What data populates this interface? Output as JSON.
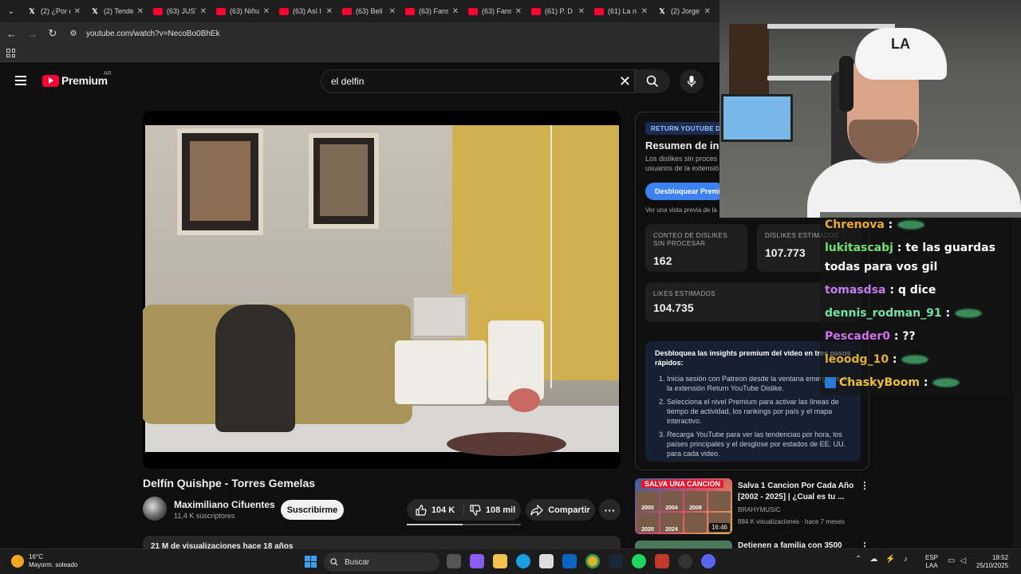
{
  "tabs": [
    {
      "icon": "x",
      "label": "(2) ¿Por q"
    },
    {
      "icon": "x",
      "label": "(2) Tende"
    },
    {
      "icon": "youtube",
      "label": "(63) JUST"
    },
    {
      "icon": "youtube",
      "label": "(63) Niñu"
    },
    {
      "icon": "youtube",
      "label": "(63) Así l"
    },
    {
      "icon": "youtube",
      "label": "(63) Beli"
    },
    {
      "icon": "youtube",
      "label": "(63) Fans"
    },
    {
      "icon": "youtube",
      "label": "(63) Fans"
    },
    {
      "icon": "youtube",
      "label": "(61) P. D"
    },
    {
      "icon": "youtube",
      "label": "(61) La n"
    },
    {
      "icon": "x",
      "label": "(2) Jorge"
    }
  ],
  "address": {
    "url": "youtube.com/watch?v=NecoBo0BhEk"
  },
  "youtube": {
    "logo": "Premium",
    "region": "AR",
    "search_value": "el delfin"
  },
  "video": {
    "title": "Delfín Quishpe - Torres Gemelas",
    "channel": "Maximiliano Cifuentes",
    "subscribers": "11,4 K suscriptores",
    "subscribe_label": "Suscribirme",
    "likes": "104 K",
    "dislikes": "108 mil",
    "like_ratio": 0.49,
    "share_label": "Compartir",
    "description_preview": "21 M de visualizaciones  hace 18 años"
  },
  "ryd_panel": {
    "badge": "RETURN YOUTUBE D",
    "title": "Resumen de insi",
    "description": "Los dislikes sin proces usuarios de la extensió",
    "unlock_label": "Desbloquear Premi",
    "preview_text": "Ver una vista previa de la",
    "raw_dislikes_label": "CONTEO DE DISLIKES SIN PROCESAR",
    "raw_dislikes_value": "162",
    "est_dislikes_label": "DISLIKES ESTIMADOS",
    "est_dislikes_value": "107.773",
    "est_likes_label": "LIKES ESTIMADOS",
    "est_likes_value": "104.735",
    "insight_heading": "Desbloquea las insights premium del video en tres pasos rápidos:",
    "steps": [
      "Inicia sesión con Patreon desde la ventana emergente de la extensión Return YouTube Dislike.",
      "Selecciona el nivel Premium para activar las líneas de tiempo de actividad, los rankings por país y el mapa interactivo.",
      "Recarga YouTube para ver las tendencias por hora, los países principales y el desglose por estados de EE. UU. para cada video."
    ]
  },
  "recommendations": [
    {
      "banner": "SALVA UNA CANCION",
      "years": [
        "2000",
        "2004",
        "2008",
        "",
        "2020",
        "2024",
        "",
        ""
      ],
      "duration": "16:46",
      "title": "Salva 1 Cancion Por Cada Año [2002 - 2025] | ¿Cual es tu ...",
      "channel": "BRAHYMUSIC",
      "meta": "884 K visualizaciones · hace 7 meses"
    },
    {
      "title": "Detienen a familia con 3500"
    }
  ],
  "chat": [
    {
      "user": "Chrenova",
      "color": "#f0a830",
      "text": "",
      "emote": true
    },
    {
      "user": "lukitascabj",
      "color": "#6ee26e",
      "text": "te las guardas todas para vos gil",
      "emote": false
    },
    {
      "user": "tomasdsa",
      "color": "#c27ef0",
      "text": "q dice",
      "emote": false
    },
    {
      "user": "dennis_rodman_91",
      "color": "#6ee2a8",
      "text": "",
      "emote": true
    },
    {
      "user": "Pescader0",
      "color": "#d36ef0",
      "text": "??",
      "emote": false
    },
    {
      "user": "leoodg_10",
      "color": "#e0b030",
      "text": "",
      "emote": true
    },
    {
      "user": "ChaskyBoom",
      "color": "#f0c030",
      "text": "",
      "emote": true
    }
  ],
  "taskbar": {
    "weather_temp": "16°C",
    "weather_desc": "Mayorm. soleado",
    "search_placeholder": "Buscar",
    "lang": "ESP",
    "lang_sub": "LAA",
    "time": "18:52",
    "date": "25/10/2025"
  }
}
